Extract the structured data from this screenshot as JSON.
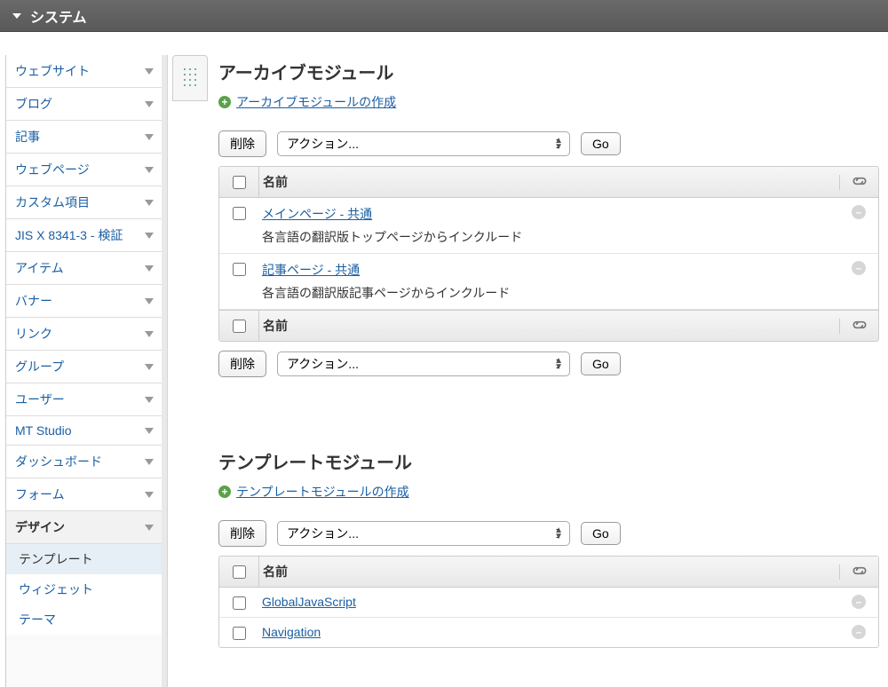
{
  "topbar": {
    "title": "システム"
  },
  "sidebar": {
    "items": [
      {
        "label": "ウェブサイト"
      },
      {
        "label": "ブログ"
      },
      {
        "label": "記事"
      },
      {
        "label": "ウェブページ"
      },
      {
        "label": "カスタム項目"
      },
      {
        "label": "JIS X 8341-3 - 検証"
      },
      {
        "label": "アイテム"
      },
      {
        "label": "バナー"
      },
      {
        "label": "リンク"
      },
      {
        "label": "グループ"
      },
      {
        "label": "ユーザー"
      },
      {
        "label": "MT Studio"
      },
      {
        "label": "ダッシュボード"
      },
      {
        "label": "フォーム"
      },
      {
        "label": "デザイン"
      }
    ],
    "design_children": [
      {
        "label": "テンプレート",
        "selected": true
      },
      {
        "label": "ウィジェット",
        "selected": false
      },
      {
        "label": "テーマ",
        "selected": false
      }
    ]
  },
  "sections": {
    "archive": {
      "heading": "アーカイブモジュール",
      "create_link": "アーカイブモジュールの作成",
      "toolbar": {
        "delete": "削除",
        "action_placeholder": "アクション...",
        "go": "Go"
      },
      "col_name": "名前",
      "rows": [
        {
          "title": "メインページ - 共通",
          "desc": "各言語の翻訳版トップページからインクルード"
        },
        {
          "title": "記事ページ - 共通",
          "desc": "各言語の翻訳版記事ページからインクルード"
        }
      ]
    },
    "template": {
      "heading": "テンプレートモジュール",
      "create_link": "テンプレートモジュールの作成",
      "toolbar": {
        "delete": "削除",
        "action_placeholder": "アクション...",
        "go": "Go"
      },
      "col_name": "名前",
      "rows": [
        {
          "title": "GlobalJavaScript"
        },
        {
          "title": "Navigation"
        }
      ]
    }
  }
}
